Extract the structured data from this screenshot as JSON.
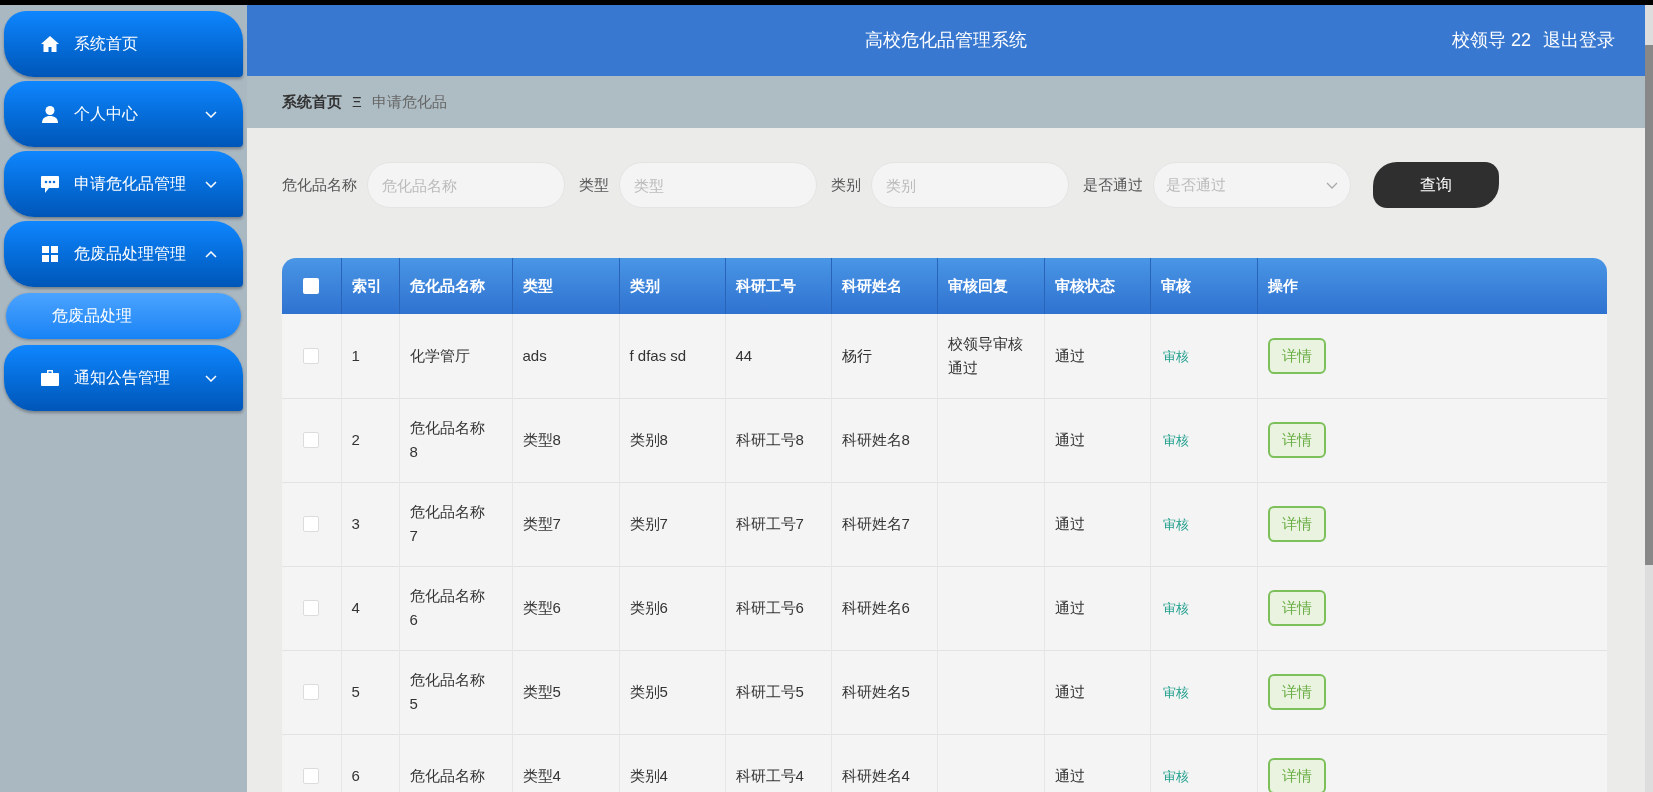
{
  "sidebar": {
    "items": [
      {
        "label": "系统首页",
        "selected": false
      },
      {
        "label": "个人中心",
        "selected": false,
        "expanded": false
      },
      {
        "label": "申请危化品管理",
        "selected": false,
        "expanded": false
      },
      {
        "label": "危废品处理管理",
        "selected": false,
        "expanded": true,
        "children": [
          {
            "label": "危废品处理",
            "selected": true
          }
        ]
      },
      {
        "label": "通知公告管理",
        "selected": false,
        "expanded": false
      }
    ]
  },
  "header": {
    "title": "高校危化品管理系统",
    "user": "校领导 22",
    "logout": "退出登录"
  },
  "breadcrumb": {
    "home": "系统首页",
    "separator": "Ξ",
    "current": "申请危化品"
  },
  "filters": [
    {
      "kind": "input",
      "label": "危化品名称",
      "placeholder": "危化品名称"
    },
    {
      "kind": "input",
      "label": "类型",
      "placeholder": "类型"
    },
    {
      "kind": "input",
      "label": "类别",
      "placeholder": "类别"
    },
    {
      "kind": "select",
      "label": "是否通过",
      "placeholder": "是否通过"
    }
  ],
  "search_button": "查询",
  "table": {
    "all_checked": false,
    "columns": [
      "索引",
      "危化品名称",
      "类型",
      "类别",
      "科研工号",
      "科研姓名",
      "审核回复",
      "审核状态",
      "审核",
      "操作"
    ],
    "rows": [
      {
        "checked": false,
        "cells": [
          "1",
          "化学管厅",
          "ads",
          "f dfas sd",
          "44",
          "杨行",
          "校领导审核通过",
          "通过"
        ],
        "review": "审核",
        "action": "详情"
      },
      {
        "checked": false,
        "cells": [
          "2",
          "危化品名称8",
          "类型8",
          "类别8",
          "科研工号8",
          "科研姓名8",
          "",
          "通过"
        ],
        "review": "审核",
        "action": "详情"
      },
      {
        "checked": false,
        "cells": [
          "3",
          "危化品名称7",
          "类型7",
          "类别7",
          "科研工号7",
          "科研姓名7",
          "",
          "通过"
        ],
        "review": "审核",
        "action": "详情"
      },
      {
        "checked": false,
        "cells": [
          "4",
          "危化品名称6",
          "类型6",
          "类别6",
          "科研工号6",
          "科研姓名6",
          "",
          "通过"
        ],
        "review": "审核",
        "action": "详情"
      },
      {
        "checked": false,
        "cells": [
          "5",
          "危化品名称5",
          "类型5",
          "类别5",
          "科研工号5",
          "科研姓名5",
          "",
          "通过"
        ],
        "review": "审核",
        "action": "详情"
      },
      {
        "checked": false,
        "cells": [
          "6",
          "危化品名称",
          "类型4",
          "类别4",
          "科研工号4",
          "科研姓名4",
          "",
          "通过"
        ],
        "review": "审核",
        "action": "详情"
      }
    ]
  }
}
